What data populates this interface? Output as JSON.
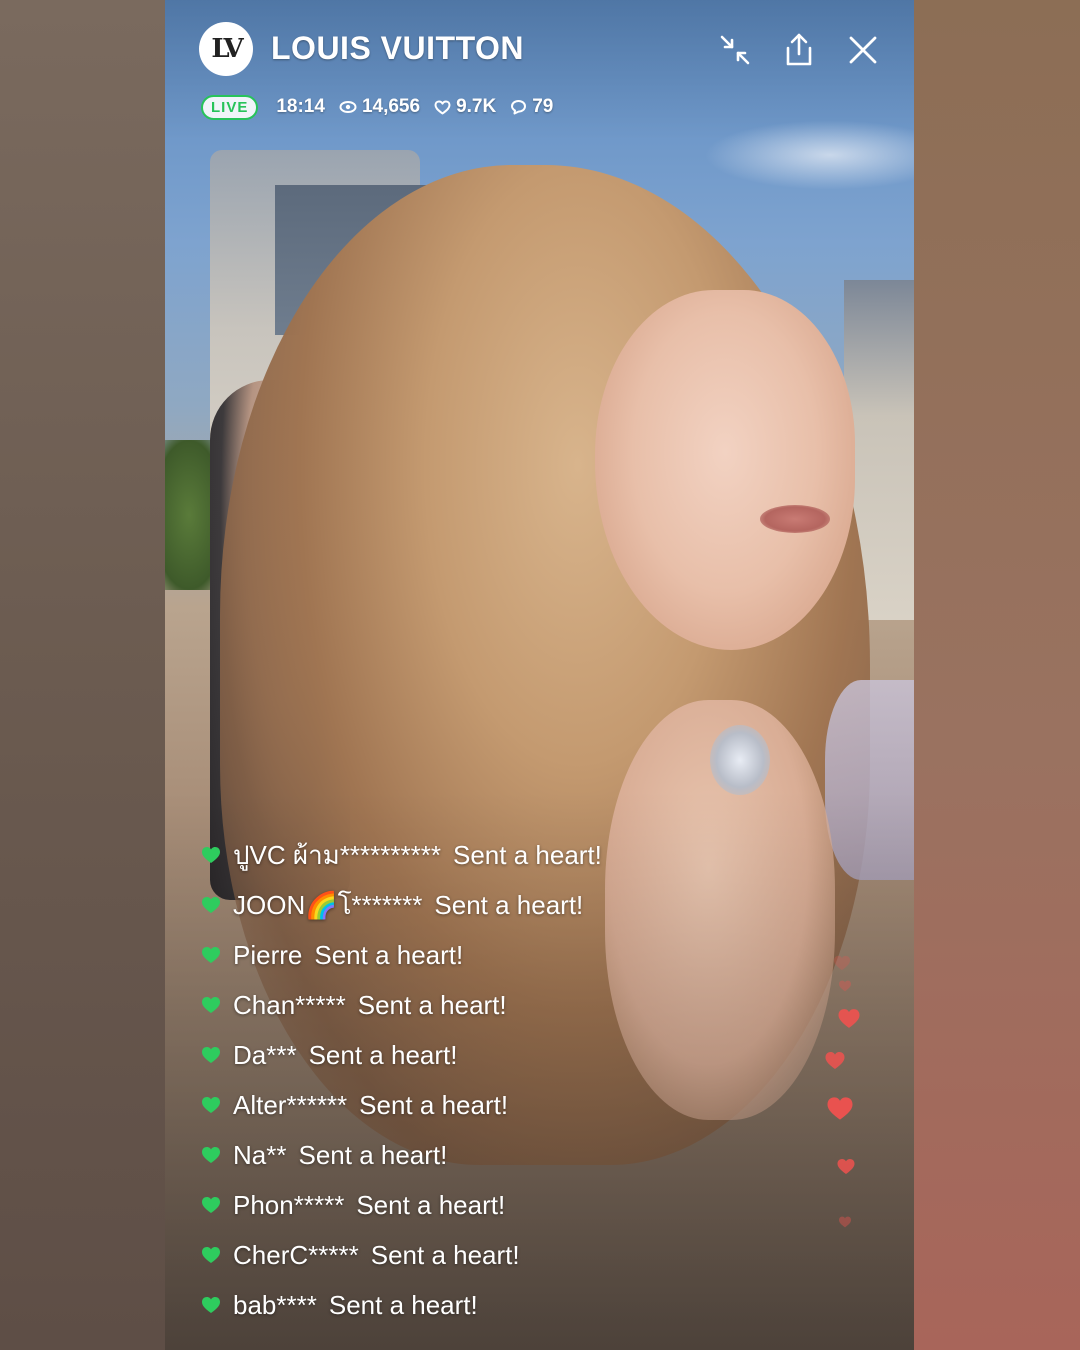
{
  "header": {
    "logo_text": "LV",
    "brand": "LOUIS VUITTON",
    "icons": [
      "minimize-icon",
      "share-icon",
      "close-icon"
    ]
  },
  "status": {
    "live_label": "LIVE",
    "elapsed": "18:14",
    "viewers": "14,656",
    "hearts": "9.7K",
    "comments": "79"
  },
  "colors": {
    "live_green": "#27c35a",
    "chat_heart": "#2ecc5e",
    "float_heart": "#f0524f"
  },
  "chat": [
    {
      "user": "ปูVC ผ้าม**********",
      "message": "Sent a heart!"
    },
    {
      "user": "JOON🌈โ*******",
      "message": "Sent a heart!"
    },
    {
      "user": "Pierre",
      "message": "Sent a heart!"
    },
    {
      "user": "Chan*****",
      "message": "Sent a heart!"
    },
    {
      "user": "Da***",
      "message": "Sent a heart!"
    },
    {
      "user": "Alter******",
      "message": "Sent a heart!"
    },
    {
      "user": "Na**",
      "message": "Sent a heart!"
    },
    {
      "user": "Phon*****",
      "message": "Sent a heart!"
    },
    {
      "user": "CherC*****",
      "message": "Sent a heart!"
    },
    {
      "user": "bab****",
      "message": "Sent a heart!"
    }
  ]
}
